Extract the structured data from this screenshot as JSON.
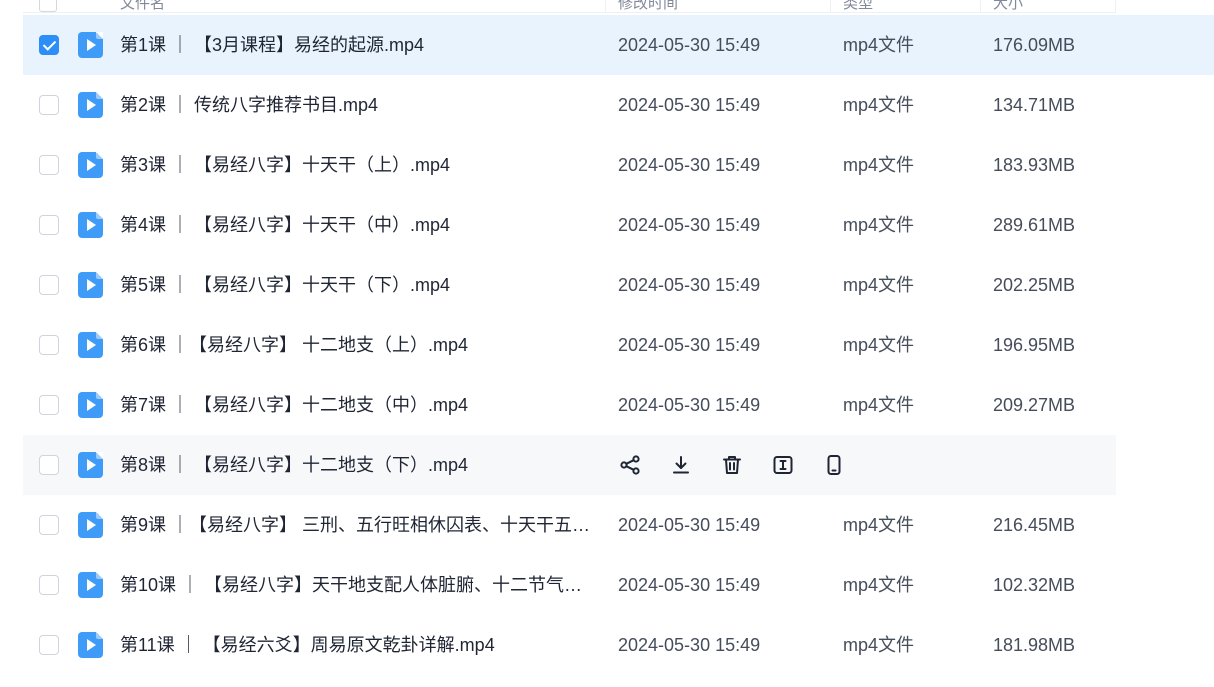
{
  "header": {
    "columns": [
      "文件名",
      "修改时间",
      "类型",
      "大小"
    ]
  },
  "rows": [
    {
      "name": "第1课 ｜ 【3月课程】易经的起源.mp4",
      "date": "2024-05-30 15:49",
      "type": "mp4文件",
      "size": "176.09MB",
      "checked": true
    },
    {
      "name": "第2课 ｜ 传统八字推荐书目.mp4",
      "date": "2024-05-30 15:49",
      "type": "mp4文件",
      "size": "134.71MB",
      "checked": false
    },
    {
      "name": "第3课 ｜ 【易经八字】十天干（上）.mp4",
      "date": "2024-05-30 15:49",
      "type": "mp4文件",
      "size": "183.93MB",
      "checked": false
    },
    {
      "name": "第4课 ｜ 【易经八字】十天干（中）.mp4",
      "date": "2024-05-30 15:49",
      "type": "mp4文件",
      "size": "289.61MB",
      "checked": false
    },
    {
      "name": "第5课 ｜ 【易经八字】十天干（下）.mp4",
      "date": "2024-05-30 15:49",
      "type": "mp4文件",
      "size": "202.25MB",
      "checked": false
    },
    {
      "name": "第6课 ｜【易经八字】 十二地支（上）.mp4",
      "date": "2024-05-30 15:49",
      "type": "mp4文件",
      "size": "196.95MB",
      "checked": false
    },
    {
      "name": "第7课 ｜ 【易经八字】十二地支（中）.mp4",
      "date": "2024-05-30 15:49",
      "type": "mp4文件",
      "size": "209.27MB",
      "checked": false
    },
    {
      "name": "第8课 ｜ 【易经八字】十二地支（下）.mp4",
      "date": "",
      "type": "",
      "size": "",
      "checked": false
    },
    {
      "name": "第9课 ｜【易经八字】 三刑、五行旺相休囚表、十天干五…",
      "date": "2024-05-30 15:49",
      "type": "mp4文件",
      "size": "216.45MB",
      "checked": false
    },
    {
      "name": "第10课 ｜ 【易经八字】天干地支配人体脏腑、十二节气…",
      "date": "2024-05-30 15:49",
      "type": "mp4文件",
      "size": "102.32MB",
      "checked": false
    },
    {
      "name": "第11课 ｜ 【易经六爻】周易原文乾卦详解.mp4",
      "date": "2024-05-30 15:49",
      "type": "mp4文件",
      "size": "181.98MB",
      "checked": false
    }
  ],
  "hover_actions": [
    "share-icon",
    "download-icon",
    "delete-icon",
    "rename-icon",
    "mobile-icon"
  ],
  "colors": {
    "accent": "#2c8ef6",
    "selected_row": "#e9f3fd",
    "hover_row": "#f7f8fa",
    "file_icon": "#3e9bf7"
  }
}
